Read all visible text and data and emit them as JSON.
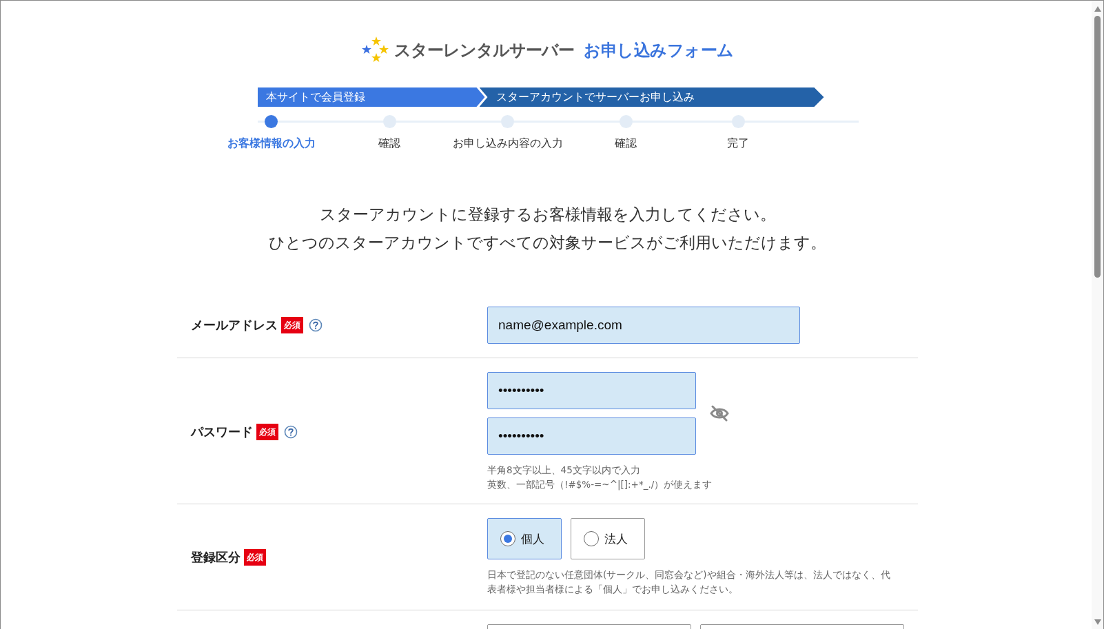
{
  "header": {
    "brand": "スターレンタルサーバー",
    "form_title": "お申し込みフォーム"
  },
  "phases": [
    {
      "label": "本サイトで会員登録",
      "selected": true
    },
    {
      "label": "スターアカウントでサーバーお申し込み",
      "selected": false
    }
  ],
  "steps": [
    {
      "label": "お客様情報の入力",
      "selected": true
    },
    {
      "label": "確認",
      "selected": false
    },
    {
      "label": "お申し込み内容の入力",
      "selected": false
    },
    {
      "label": "確認",
      "selected": false
    },
    {
      "label": "完了",
      "selected": false
    }
  ],
  "intro": [
    "スターアカウントに登録するお客様情報を入力してください。",
    "ひとつのスターアカウントですべての対象サービスがご利用いただけます。"
  ],
  "fields": [
    {
      "kind": "email",
      "label": "メールアドレス",
      "required": "必須",
      "help": true,
      "value": "name@example.com"
    },
    {
      "kind": "password",
      "label": "パスワード",
      "required": "必須",
      "help": true,
      "values": [
        "••••••••••",
        "••••••••••"
      ],
      "notes": [
        "半角8文字以上、45文字以内で入力",
        "英数、一部記号（!#$%-=~^|[]:+*_./）が使えます"
      ]
    },
    {
      "kind": "radio",
      "label": "登録区分",
      "required": "必須",
      "help": false,
      "options": [
        {
          "label": "個人",
          "selected": true
        },
        {
          "label": "法人",
          "selected": false
        }
      ],
      "notes": [
        "日本で登記のない任意団体(サークル、同窓会など)や組合・海外法人等は、法人ではなく、代表者様や担当者様による「個人」でお申し込みください。"
      ]
    },
    {
      "kind": "name",
      "help": false
    }
  ]
}
